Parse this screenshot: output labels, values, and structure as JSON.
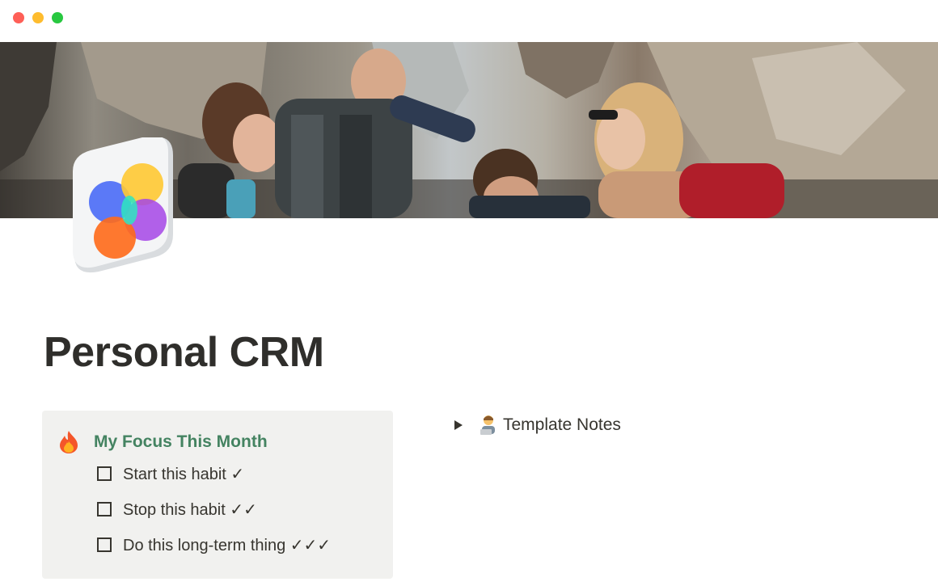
{
  "window": {
    "controls": [
      "close",
      "minimize",
      "zoom"
    ],
    "colors": {
      "close": "#fe5f57",
      "minimize": "#febc2e",
      "zoom": "#28c840"
    }
  },
  "cover": {
    "subject": "group of friends laughing on a mountain hike"
  },
  "page": {
    "icon": "flower-app-icon",
    "title": "Personal CRM"
  },
  "callout": {
    "emoji": "fire-icon",
    "heading": "My Focus This Month",
    "heading_color": "#448361",
    "background": "#f1f1ef",
    "todos": [
      {
        "text": "Start this habit ✓",
        "checked": false
      },
      {
        "text": "Stop this habit ✓✓",
        "checked": false
      },
      {
        "text": "Do this long-term thing ✓✓✓",
        "checked": false
      }
    ]
  },
  "toggle": {
    "emoji": "technologist-icon",
    "label": "Template Notes",
    "expanded": false
  }
}
